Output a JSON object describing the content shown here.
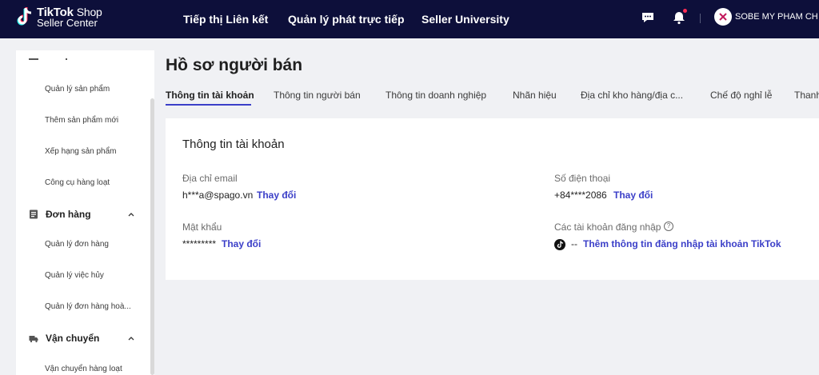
{
  "header": {
    "logo_line1": "TikTok",
    "logo_line1b": "Shop",
    "logo_line2": "Seller Center",
    "nav": [
      "Tiếp thị Liên kết",
      "Quản lý phát trực tiếp",
      "Seller University"
    ],
    "shop_name": "SOBE MY PHAM CH"
  },
  "sidebar": {
    "items_top": [
      "Quản lý sản phẩm",
      "Thêm sản phẩm mới",
      "Xếp hạng sản phẩm",
      "Công cụ hàng loạt"
    ],
    "group_orders": "Đơn hàng",
    "items_orders": [
      "Quản lý đơn hàng",
      "Quản lý việc hủy",
      "Quản lý đơn hàng hoà..."
    ],
    "group_shipping": "Vận chuyển",
    "items_shipping": [
      "Vận chuyển hàng loạt"
    ]
  },
  "page": {
    "title": "Hồ sơ người bán",
    "tabs": [
      "Thông tin tài khoản",
      "Thông tin người bán",
      "Thông tin doanh nghiệp",
      "Nhãn hiệu",
      "Địa chỉ kho hàng/địa c...",
      "Chế độ nghỉ lễ",
      "Thanh"
    ]
  },
  "account": {
    "title": "Thông tin tài khoản",
    "email_label": "Địa chỉ email",
    "email_value": "h***a@spago.vn",
    "phone_label": "Số điện thoại",
    "phone_value": "+84****2086",
    "password_label": "Mật khẩu",
    "password_value": "*********",
    "change_label": "Thay đổi",
    "login_accounts_label": "Các tài khoản đăng nhập",
    "login_dash": "--",
    "add_tiktok_login": "Thêm thông tin đăng nhập tài khoản TikTok"
  },
  "colors": {
    "navbar": "#0d0f3a",
    "accent": "#3b3fc8",
    "notification_dot": "#fe2c55"
  }
}
